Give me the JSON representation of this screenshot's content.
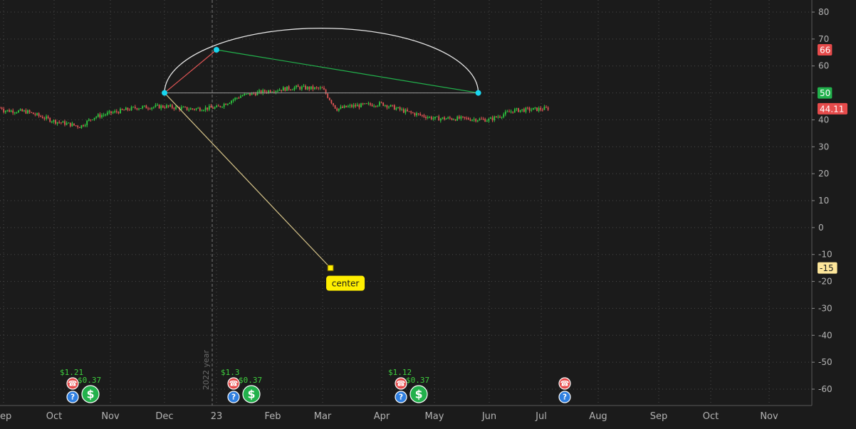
{
  "colors": {
    "background": "#1b1b1b",
    "grid": "#4a4a4a",
    "axis_text": "#b4b4b4",
    "candle_up": "#2ecc40",
    "candle_down": "#e05555",
    "arc": "#e6e6e6",
    "handle": "#19d6f0",
    "green_line": "#22b14c",
    "red_line": "#e05555",
    "center_line": "#d8c58a",
    "center_label_bg": "#ffee00",
    "badge_red": "#e64b4b",
    "badge_green": "#22b14c",
    "badge_yellow": "#fde69a",
    "event_red": "#e64b4b",
    "event_blue": "#2f7fe0",
    "event_green": "#22b14c"
  },
  "chart_data": {
    "type": "line",
    "price_series": {
      "name": "",
      "x": [
        "Sep",
        "Sep 15",
        "Oct",
        "Oct 8",
        "Oct 15",
        "Oct 22",
        "Nov",
        "Nov 15",
        "Dec",
        "Dec 15",
        "23",
        "Jan 15",
        "Feb",
        "Feb 15",
        "Mar",
        "Mar 8",
        "Mar 15",
        "Apr",
        "Apr 15",
        "May",
        "May 15",
        "Jun",
        "Jun 15",
        "Jul",
        "Jul 8"
      ],
      "values": [
        43.5,
        43.0,
        39.5,
        38.5,
        37.5,
        41.0,
        42.5,
        44.5,
        45.0,
        44.0,
        44.5,
        49.0,
        51.0,
        52.0,
        51.5,
        44.0,
        45.0,
        46.0,
        43.0,
        40.5,
        40.5,
        40.0,
        43.5,
        44.0,
        44.5
      ]
    },
    "y_axis": {
      "ticks": [
        80,
        70,
        60,
        50,
        40,
        30,
        20,
        10,
        0,
        -10,
        -20,
        -30,
        -40,
        -50,
        -60
      ],
      "range": [
        -64,
        84
      ]
    },
    "x_axis": {
      "ticks": [
        "ep",
        "Oct",
        "Nov",
        "Dec",
        "23",
        "Feb",
        "Mar",
        "Apr",
        "May",
        "Jun",
        "Jul",
        "Aug",
        "Sep",
        "Oct",
        "Nov"
      ]
    },
    "year_label": "2022 year",
    "drawing": {
      "arc_start": {
        "x": "Dec",
        "y": 50
      },
      "arc_peak": {
        "x": "23",
        "y": 66
      },
      "arc_end": {
        "x": "May 25",
        "y": 50
      },
      "center": {
        "x": "Mar 5",
        "y": -15
      },
      "center_label": "center"
    },
    "price_badges": [
      {
        "value": "66",
        "y": 66,
        "style": "red"
      },
      {
        "value": "50",
        "y": 50,
        "style": "green"
      },
      {
        "value": "44.11",
        "y": 44.11,
        "style": "red"
      },
      {
        "value": "-15",
        "y": -15,
        "style": "yellow"
      }
    ],
    "events": [
      {
        "month": "Oct",
        "earnings": "$1.21",
        "dividend": "$0.37",
        "has_dividend": true
      },
      {
        "month": "23",
        "earnings": "$1.3",
        "dividend": "$0.37",
        "has_dividend": true
      },
      {
        "month": "Apr",
        "earnings": "$1.12",
        "dividend": "$0.37",
        "has_dividend": true
      },
      {
        "month": "Jul",
        "earnings": "",
        "dividend": "",
        "has_dividend": false
      }
    ],
    "grid": true
  }
}
